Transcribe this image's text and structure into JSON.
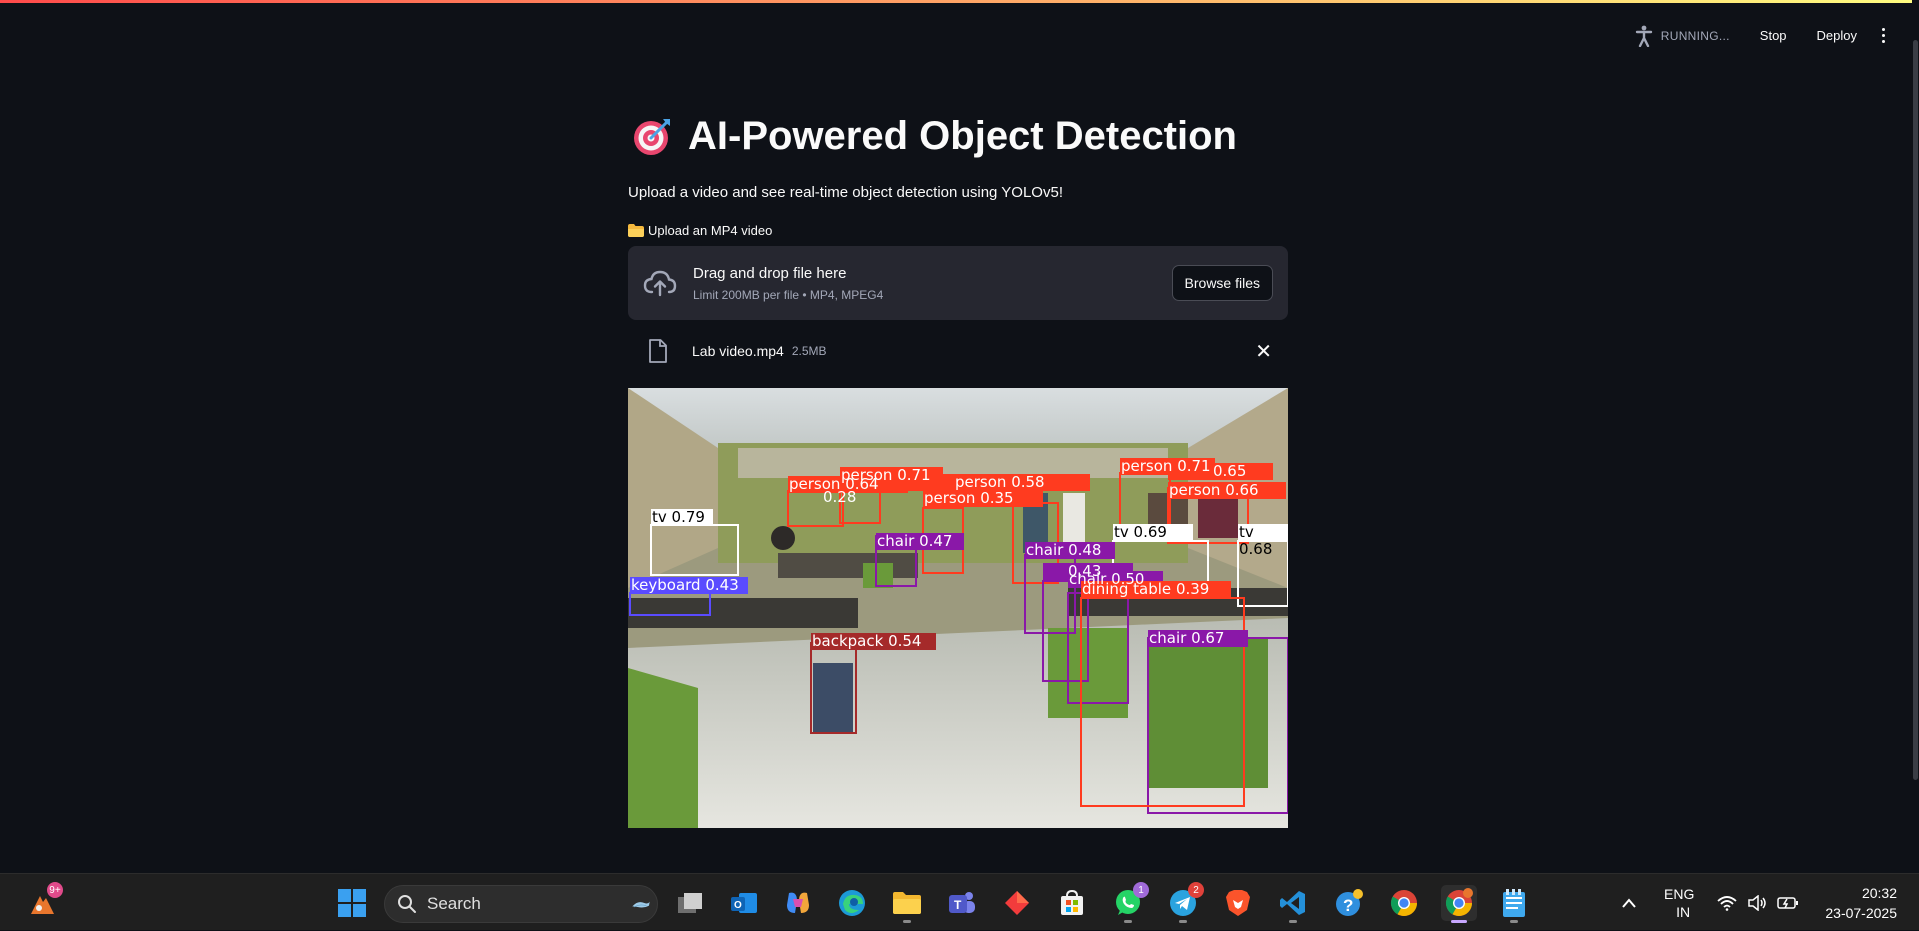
{
  "header": {
    "status_text": "RUNNING...",
    "stop_label": "Stop",
    "deploy_label": "Deploy"
  },
  "page": {
    "title": "AI-Powered Object Detection",
    "subtitle": "Upload a video and see real-time object detection using YOLOv5!"
  },
  "uploader": {
    "label": "Upload an MP4 video",
    "drop_text": "Drag and drop file here",
    "limit_text": "Limit 200MB per file • MP4, MPEG4",
    "browse_label": "Browse files",
    "file_name": "Lab video.mp4",
    "file_size": "2.5MB"
  },
  "detections": [
    {
      "label": "tv",
      "score": "0.79",
      "color": "#ffffff"
    },
    {
      "label": "keyboard",
      "score": "0.43",
      "color": "#5a4bff"
    },
    {
      "label": "person",
      "score": "0.71",
      "color": "#ff3b1f"
    },
    {
      "label": "person",
      "score": "0.64",
      "color": "#ff3b1f"
    },
    {
      "label": "person",
      "score": "0.28",
      "color": "#ff3b1f"
    },
    {
      "label": "person",
      "score": "0.35",
      "color": "#ff3b1f"
    },
    {
      "label": "person",
      "score": "0.58",
      "color": "#ff3b1f"
    },
    {
      "label": "person",
      "score": "0.71",
      "color": "#ff3b1f"
    },
    {
      "label": "person",
      "score": "0.65",
      "color": "#ff3b1f"
    },
    {
      "label": "person",
      "score": "0.66",
      "color": "#ff3b1f"
    },
    {
      "label": "chair",
      "score": "0.47",
      "color": "#8a18a8"
    },
    {
      "label": "chair",
      "score": "0.48",
      "color": "#8a18a8"
    },
    {
      "label": "chair",
      "score": "0.50",
      "color": "#8a18a8"
    },
    {
      "label": "chair",
      "score": "0.43",
      "color": "#8a18a8"
    },
    {
      "label": "chair",
      "score": "0.67",
      "color": "#8a18a8"
    },
    {
      "label": "tv",
      "score": "0.69",
      "color": "#ffffff"
    },
    {
      "label": "tv",
      "score": "0.68",
      "color": "#ffffff"
    },
    {
      "label": "dining table",
      "score": "0.39",
      "color": "#ff3b1f"
    },
    {
      "label": "backpack",
      "score": "0.54",
      "color": "#a52a2a"
    }
  ],
  "taskbar": {
    "search_placeholder": "Search",
    "widget_badge": "9+",
    "whatsapp_badge": "1",
    "telegram_badge": "2",
    "language": "ENG",
    "region": "IN",
    "time": "20:32",
    "date": "23-07-2025"
  }
}
